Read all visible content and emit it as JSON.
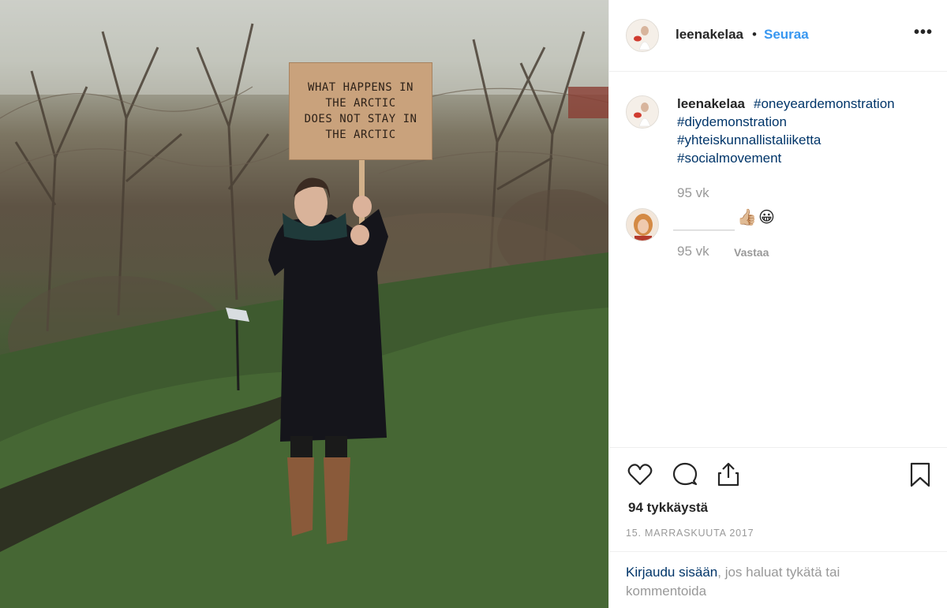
{
  "photo": {
    "sign_text": "WHAT HAPPENS IN\nTHE ARCTIC\nDOES NOT STAY IN\nTHE ARCTIC"
  },
  "header": {
    "username": "leenakelaa",
    "separator": "•",
    "follow_label": "Seuraa",
    "more_label": "•••"
  },
  "caption": {
    "username": "leenakelaa",
    "hashtags": [
      "#oneyeardemonstration",
      "#diydemonstration",
      "#yhteiskunnallistaliiketta",
      "#socialmovement"
    ],
    "time": "95 vk"
  },
  "comment": {
    "emojis": [
      "👍🏼",
      "😀"
    ],
    "time": "95 vk",
    "reply_label": "Vastaa"
  },
  "actions": {
    "like_icon": "heart-icon",
    "comment_icon": "comment-icon",
    "share_icon": "share-icon",
    "save_icon": "bookmark-icon",
    "likes_text": "94 tykkäystä",
    "date_text": "15. MARRASKUUTA 2017"
  },
  "login": {
    "link_text": "Kirjaudu sisään",
    "rest_text": ", jos haluat tykätä tai kommentoida"
  },
  "colors": {
    "link_blue": "#3897f0",
    "hashtag_blue": "#003569",
    "muted": "#999999",
    "text": "#262626"
  }
}
